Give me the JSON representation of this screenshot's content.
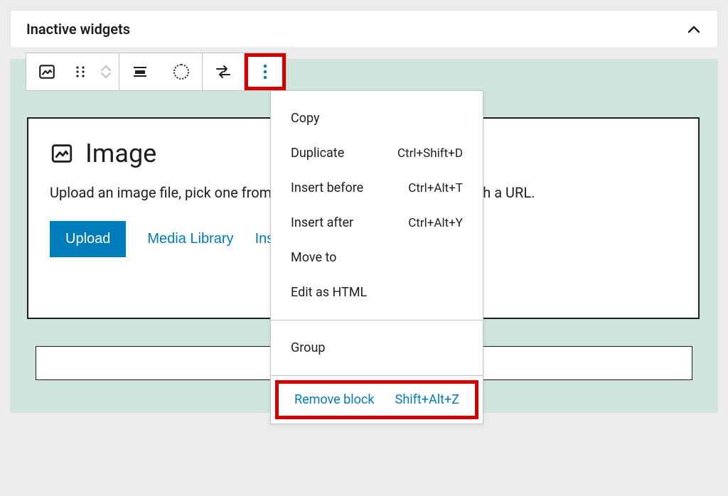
{
  "panel": {
    "title": "Inactive widgets"
  },
  "block": {
    "title": "Image",
    "description": "Upload an image file, pick one from your media library, or add one with a URL.",
    "desc_suffix_visible": "RL.",
    "upload_label": "Upload",
    "media_library_label": "Media Library",
    "insert_label": "Insert from URL"
  },
  "toolbar": {
    "image_block_name": "image-block-icon",
    "drag_name": "drag-icon",
    "move_name": "move-updown-icon",
    "align_name": "align-icon",
    "crop_name": "crop-icon",
    "replace_name": "replace-icon",
    "options_name": "options-icon"
  },
  "menu": {
    "copy": {
      "label": "Copy",
      "shortcut": ""
    },
    "duplicate": {
      "label": "Duplicate",
      "shortcut": "Ctrl+Shift+D"
    },
    "insert_before": {
      "label": "Insert before",
      "shortcut": "Ctrl+Alt+T"
    },
    "insert_after": {
      "label": "Insert after",
      "shortcut": "Ctrl+Alt+Y"
    },
    "move_to": {
      "label": "Move to",
      "shortcut": ""
    },
    "edit_html": {
      "label": "Edit as HTML",
      "shortcut": ""
    },
    "group": {
      "label": "Group",
      "shortcut": ""
    },
    "remove": {
      "label": "Remove block",
      "shortcut": "Shift+Alt+Z"
    }
  },
  "colors": {
    "primary": "#007cba",
    "highlight": "#d40000",
    "bg_area": "#cfe4db"
  }
}
